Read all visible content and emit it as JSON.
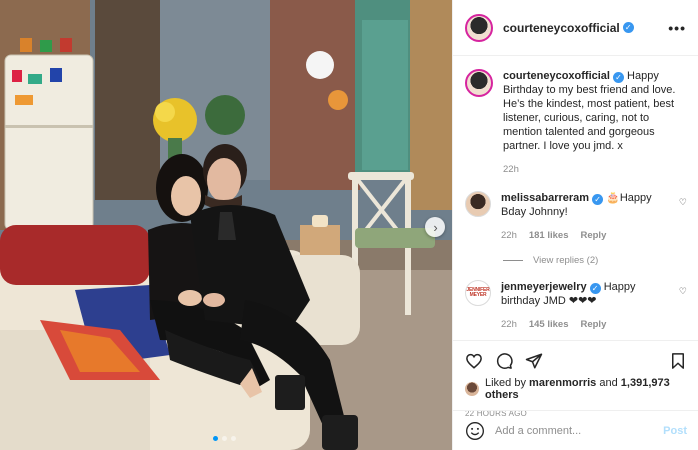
{
  "post": {
    "username": "courteneycoxofficial",
    "caption": "Happy Birthday to my best friend and love. He’s the kindest, most patient, best listener, curious, caring, not to mention talented and gorgeous partner. I love you jmd. x",
    "caption_time": "22h",
    "more_icon": "•••"
  },
  "comments": [
    {
      "username": "melissabarreram",
      "text": "🎂Happy Bday Johnny!",
      "time": "22h",
      "likes": "181 likes",
      "reply": "Reply",
      "view_replies": "View replies (2)"
    },
    {
      "username": "jenmeyerjewelry",
      "text": "Happy birthday JMD ❤❤❤",
      "time": "22h",
      "likes": "145 likes",
      "reply": "Reply",
      "avatar_text": "JENNIFER MEYER"
    }
  ],
  "likes": {
    "liked_by_prefix": "Liked by",
    "liked_by_user": "marenmorris",
    "conjunction": "and",
    "others": "1,391,973 others"
  },
  "timestamp": "22 HOURS AGO",
  "add_comment": {
    "placeholder": "Add a comment...",
    "post_label": "Post"
  },
  "carousel": {
    "next_icon": "›"
  },
  "colors": {
    "verified": "#3897f0",
    "link": "#0095f6",
    "post_disabled": "#b2dffc"
  },
  "icons": [
    "heart-icon",
    "comment-icon",
    "share-icon",
    "bookmark-icon",
    "smile-icon",
    "verified-icon",
    "chevron-right-icon"
  ]
}
